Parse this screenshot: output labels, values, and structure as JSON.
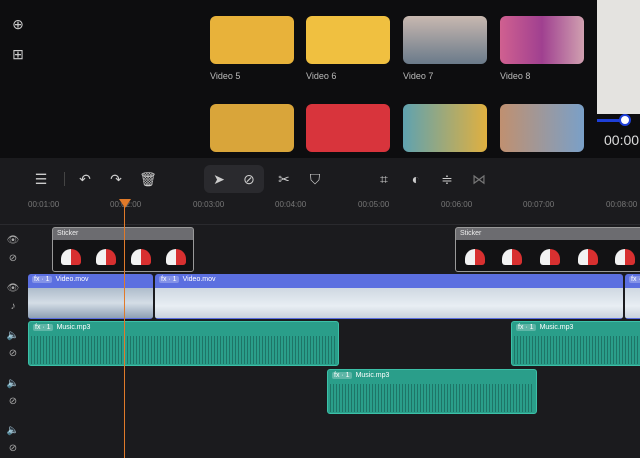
{
  "library": {
    "videos": [
      {
        "label": "Video 5",
        "color": "#e8b23a"
      },
      {
        "label": "Video 6",
        "color": "#f0c040"
      },
      {
        "label": "Video 7",
        "color": "#9aa6b4"
      },
      {
        "label": "Video 8",
        "color": "#c0407a"
      },
      {
        "color": "#d9a53a"
      },
      {
        "color": "#d8343c"
      },
      {
        "color": "#5fa2b0"
      },
      {
        "color": "#b08060"
      }
    ]
  },
  "preview": {
    "time": "00:00",
    "progress": 0.75
  },
  "toolbar": {
    "tools": [
      "add-track",
      "undo",
      "redo",
      "delete",
      "select",
      "mask",
      "split",
      "shield",
      "crop",
      "color",
      "adjust",
      "transition"
    ]
  },
  "ruler": {
    "ticks": [
      "00:01:00",
      "00:02:00",
      "00:03:00",
      "00:04:00",
      "00:05:00",
      "00:06:00",
      "00:07:00",
      "00:08:00"
    ]
  },
  "tracks": {
    "sticker": {
      "label": "Sticker"
    },
    "video": {
      "fx": "fx · 1",
      "label": "Video.mov"
    },
    "music": {
      "fx": "fx · 1",
      "label": "Music.mp3"
    }
  }
}
